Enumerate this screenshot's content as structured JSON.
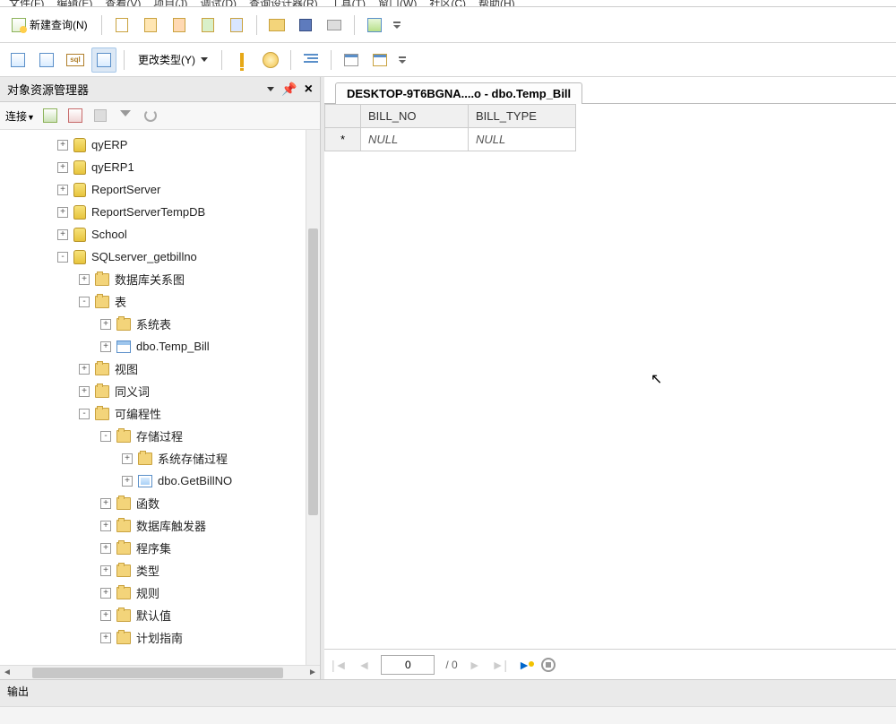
{
  "menubar": [
    "文件(F)",
    "编辑(E)",
    "查看(V)",
    "项目(J)",
    "调试(D)",
    "查询设计器(R)",
    "工具(T)",
    "窗口(W)",
    "社区(C)",
    "帮助(H)"
  ],
  "toolbar1": {
    "new_query": "新建查询(N)"
  },
  "toolbar2": {
    "change_type": "更改类型(Y)",
    "sql_label": "sql"
  },
  "object_explorer": {
    "title": "对象资源管理器",
    "connect_label": "连接"
  },
  "tree": [
    {
      "depth": 0,
      "exp": "+",
      "icon": "db",
      "label": "qyERP"
    },
    {
      "depth": 0,
      "exp": "+",
      "icon": "db",
      "label": "qyERP1"
    },
    {
      "depth": 0,
      "exp": "+",
      "icon": "db",
      "label": "ReportServer"
    },
    {
      "depth": 0,
      "exp": "+",
      "icon": "db",
      "label": "ReportServerTempDB"
    },
    {
      "depth": 0,
      "exp": "+",
      "icon": "db",
      "label": "School"
    },
    {
      "depth": 0,
      "exp": "-",
      "icon": "db",
      "label": "SQLserver_getbillno"
    },
    {
      "depth": 1,
      "exp": "+",
      "icon": "folder",
      "label": "数据库关系图"
    },
    {
      "depth": 1,
      "exp": "-",
      "icon": "folder",
      "label": "表"
    },
    {
      "depth": 2,
      "exp": "+",
      "icon": "folder",
      "label": "系统表"
    },
    {
      "depth": 2,
      "exp": "+",
      "icon": "table",
      "label": "dbo.Temp_Bill"
    },
    {
      "depth": 1,
      "exp": "+",
      "icon": "folder",
      "label": "视图"
    },
    {
      "depth": 1,
      "exp": "+",
      "icon": "folder",
      "label": "同义词"
    },
    {
      "depth": 1,
      "exp": "-",
      "icon": "folder",
      "label": "可编程性"
    },
    {
      "depth": 2,
      "exp": "-",
      "icon": "folder",
      "label": "存储过程"
    },
    {
      "depth": 3,
      "exp": "+",
      "icon": "folder",
      "label": "系统存储过程"
    },
    {
      "depth": 3,
      "exp": "+",
      "icon": "proc",
      "label": "dbo.GetBillNO"
    },
    {
      "depth": 2,
      "exp": "+",
      "icon": "folder",
      "label": "函数"
    },
    {
      "depth": 2,
      "exp": "+",
      "icon": "folder",
      "label": "数据库触发器"
    },
    {
      "depth": 2,
      "exp": "+",
      "icon": "folder",
      "label": "程序集"
    },
    {
      "depth": 2,
      "exp": "+",
      "icon": "folder",
      "label": "类型"
    },
    {
      "depth": 2,
      "exp": "+",
      "icon": "folder",
      "label": "规则"
    },
    {
      "depth": 2,
      "exp": "+",
      "icon": "folder",
      "label": "默认值"
    },
    {
      "depth": 2,
      "exp": "+",
      "icon": "folder",
      "label": "计划指南"
    }
  ],
  "tab": {
    "title": "DESKTOP-9T6BGNA....o - dbo.Temp_Bill"
  },
  "grid": {
    "columns": [
      "BILL_NO",
      "BILL_TYPE"
    ],
    "rows": [
      {
        "marker": "*",
        "values": [
          "NULL",
          "NULL"
        ],
        "null_flags": [
          true,
          true
        ]
      }
    ]
  },
  "navbar": {
    "pos": "0",
    "total": "/ 0"
  },
  "output": {
    "title": "输出"
  }
}
